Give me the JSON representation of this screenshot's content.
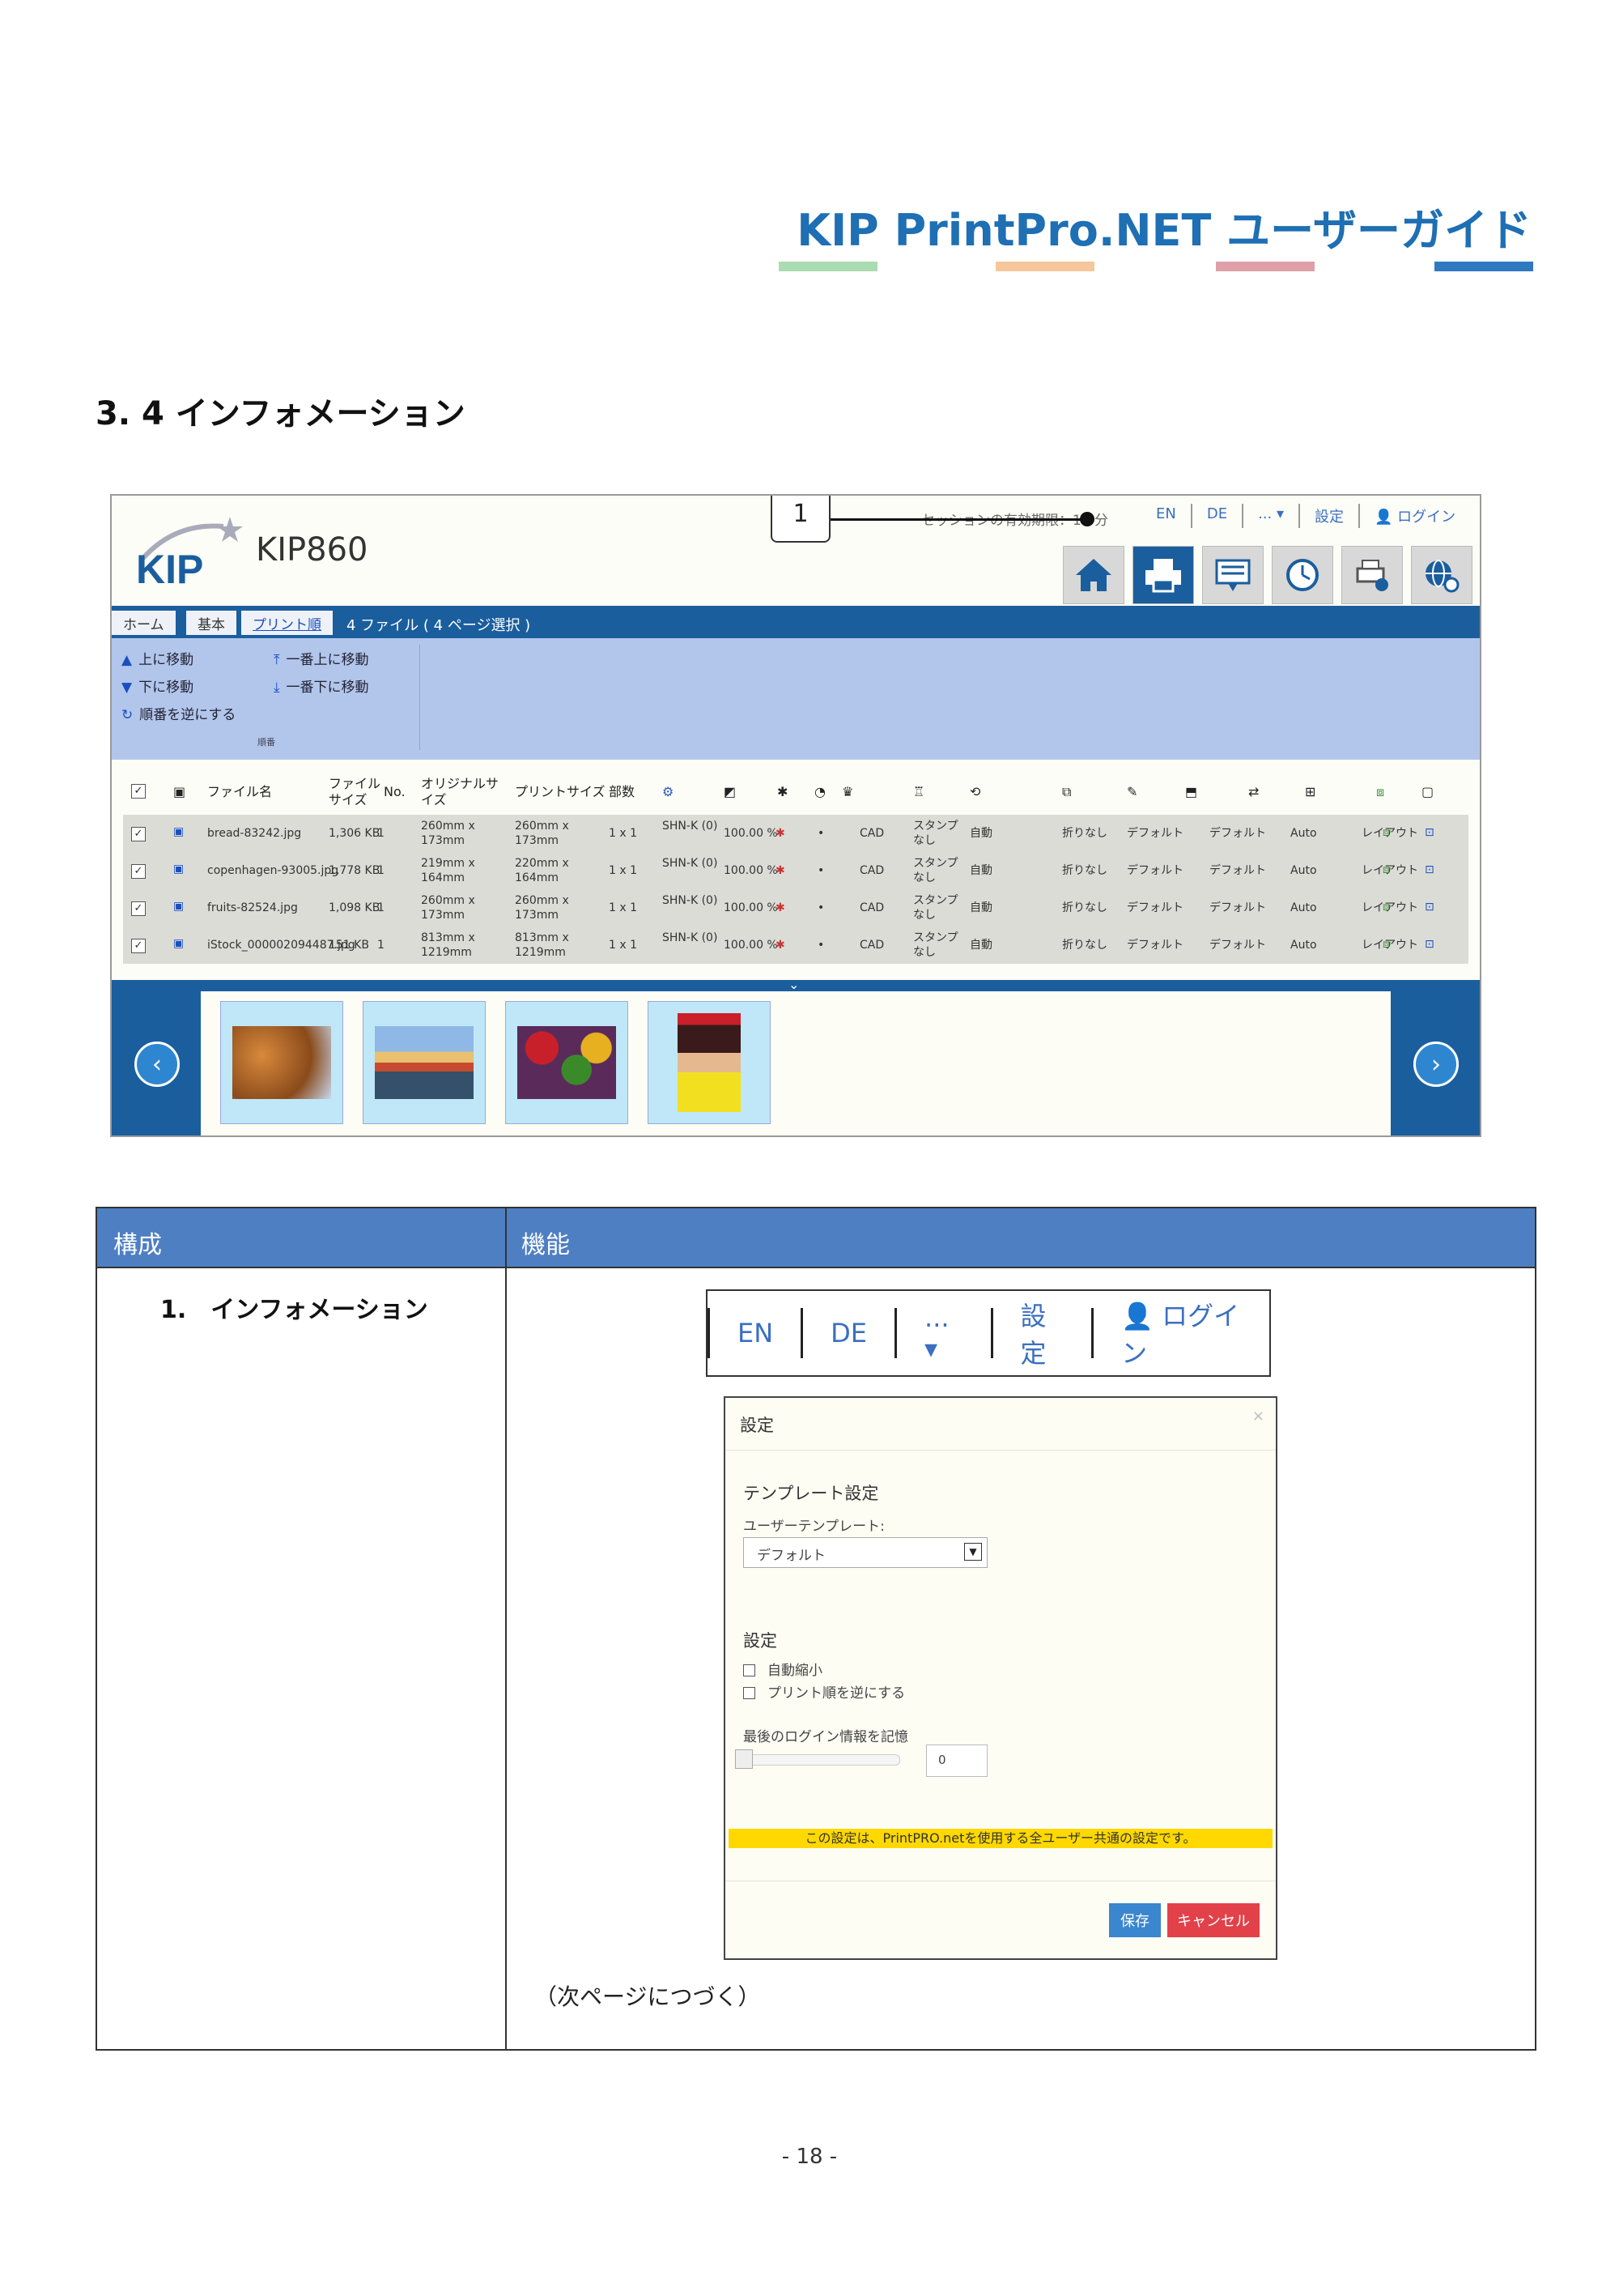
{
  "header": {
    "title": "KIP PrintPro.NET ユーザーガイド",
    "stripe_colors": [
      "#a9dcb0",
      "#f6c79a",
      "#e0a0a8",
      "#2f79c0"
    ]
  },
  "section": {
    "heading": "3. 4 インフォメーション"
  },
  "screenshot": {
    "model": "KIP860",
    "callout": "1",
    "session_text": "セッションの有効期限：17 分",
    "topnav": [
      "EN",
      "DE",
      "... ▾",
      "設定",
      "👤 ログイン"
    ],
    "nav_icons": [
      "home-icon",
      "printer-icon",
      "message-icon",
      "clock-icon",
      "print-status-icon",
      "globe-settings-icon"
    ],
    "tabs": [
      "ホーム",
      "基本",
      "プリント順"
    ],
    "file_count": "4 ファイル ( 4 ページ選択 )",
    "toolbar": {
      "move_up": "上に移動",
      "move_down": "下に移動",
      "reverse": "順番を逆にする",
      "move_top": "一番上に移動",
      "move_bottom": "一番下に移動",
      "group_label": "順番"
    },
    "columns": {
      "filename": "ファイル名",
      "filesize": "ファイル サイズ",
      "no": "No.",
      "original_size": "オリジナルサイズ",
      "print_size": "プリントサイズ",
      "copies": "部数"
    },
    "rows": [
      {
        "name": "bread-83242.jpg",
        "size": "1,306 KB",
        "no": "1",
        "orig": "260mm x 173mm",
        "print": "260mm x 173mm",
        "copies": "1 x 1",
        "media": "SHN-K (0)",
        "scale": "100.00 %",
        "cad": "CAD",
        "stamp": "スタンプなし",
        "auto": "自動",
        "fold": "折りなし",
        "def1": "デフォルト",
        "def2": "デフォルト",
        "auto2": "Auto",
        "layout": "レイアウト"
      },
      {
        "name": "copenhagen-93005.jpg",
        "size": "1,778 KB",
        "no": "1",
        "orig": "219mm x 164mm",
        "print": "220mm x 164mm",
        "copies": "1 x 1",
        "media": "SHN-K (0)",
        "scale": "100.00 %",
        "cad": "CAD",
        "stamp": "スタンプなし",
        "auto": "自動",
        "fold": "折りなし",
        "def1": "デフォルト",
        "def2": "デフォルト",
        "auto2": "Auto",
        "layout": "レイアウト"
      },
      {
        "name": "fruits-82524.jpg",
        "size": "1,098 KB",
        "no": "1",
        "orig": "260mm x 173mm",
        "print": "260mm x 173mm",
        "copies": "1 x 1",
        "media": "SHN-K (0)",
        "scale": "100.00 %",
        "cad": "CAD",
        "stamp": "スタンプなし",
        "auto": "自動",
        "fold": "折りなし",
        "def1": "デフォルト",
        "def2": "デフォルト",
        "auto2": "Auto",
        "layout": "レイアウト"
      },
      {
        "name": "iStock_000002094487.jpg",
        "size": "151 KB",
        "no": "1",
        "orig": "813mm x 1219mm",
        "print": "813mm x 1219mm",
        "copies": "1 x 1",
        "media": "SHN-K (0)",
        "scale": "100.00 %",
        "cad": "CAD",
        "stamp": "スタンプなし",
        "auto": "自動",
        "fold": "折りなし",
        "def1": "デフォルト",
        "def2": "デフォルト",
        "auto2": "Auto",
        "layout": "レイアウト"
      }
    ]
  },
  "table": {
    "col1_header": "構成",
    "col2_header": "機能",
    "row_label": "1.　インフォメーション",
    "lang_bar": [
      "EN",
      "DE",
      "... ▾",
      "設定",
      "👤 ログイン"
    ],
    "dialog": {
      "title": "設定",
      "close": "×",
      "template_heading": "テンプレート設定",
      "user_template_label": "ユーザーテンプレート:",
      "user_template_value": "デフォルト",
      "settings_heading": "設定",
      "auto_reduce": "自動縮小",
      "reverse_order": "プリント順を逆にする",
      "remember_login": "最後のログイン情報を記憶",
      "number_value": "0",
      "note": "この設定は、PrintPRO.netを使用する全ユーザー共通の設定です。",
      "save": "保存",
      "cancel": "キャンセル"
    },
    "continued": "（次ページにつづく）"
  },
  "footer": {
    "page": "- 18 -"
  }
}
